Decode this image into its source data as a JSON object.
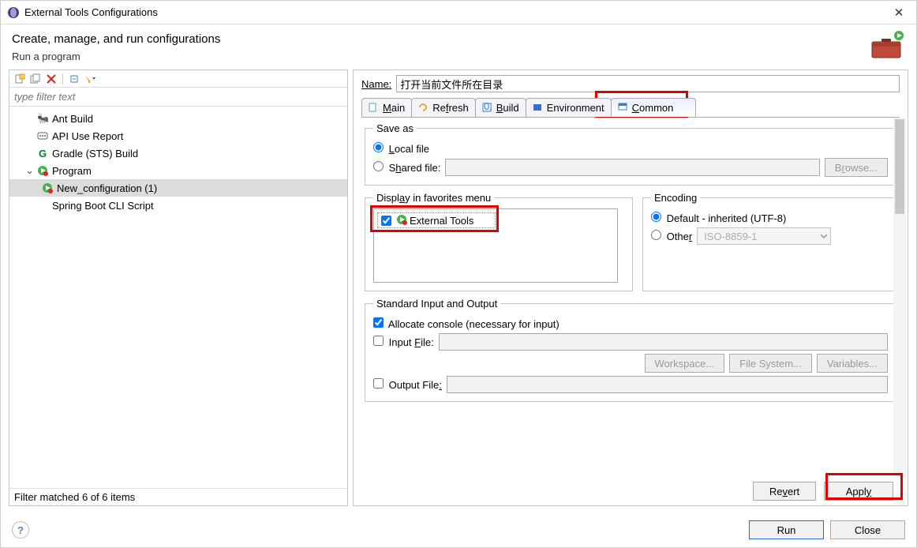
{
  "window": {
    "title": "External Tools Configurations",
    "close_glyph": "✕"
  },
  "header": {
    "title": "Create, manage, and run configurations",
    "subtitle": "Run a program"
  },
  "toolbar": {
    "new_icon": "new",
    "copy_icon": "copy",
    "delete_icon": "delete",
    "expand_icon": "expand",
    "collapse_icon": "collapse"
  },
  "filter": {
    "placeholder": "type filter text"
  },
  "tree": [
    {
      "label": "Ant Build",
      "icon": "ant"
    },
    {
      "label": "API Use Report",
      "icon": "api"
    },
    {
      "label": "Gradle (STS) Build",
      "icon": "gradle"
    },
    {
      "label": "Program",
      "icon": "program",
      "expanded": true,
      "children": [
        {
          "label": "New_configuration (1)",
          "icon": "program",
          "selected": true
        }
      ]
    },
    {
      "label": "Spring Boot CLI Script",
      "icon": "blank"
    }
  ],
  "status_line": "Filter matched 6 of 6 items",
  "name": {
    "label": "Name:",
    "value": "打开当前文件所在目录"
  },
  "tabs": [
    {
      "id": "main",
      "label": "Main",
      "underline": "M"
    },
    {
      "id": "refresh",
      "label": "Refresh",
      "underline": "f"
    },
    {
      "id": "build",
      "label": "Build",
      "underline": "B"
    },
    {
      "id": "environment",
      "label": "Environment"
    },
    {
      "id": "common",
      "label": "Common",
      "underline": "C",
      "active": true
    }
  ],
  "saveas": {
    "legend": "Save as",
    "local": "Local file",
    "shared": "Shared file:",
    "browse": "Browse..."
  },
  "favorites": {
    "legend": "Display in favorites menu",
    "item": "External Tools"
  },
  "encoding": {
    "legend": "Encoding",
    "default": "Default - inherited (UTF-8)",
    "other": "Other",
    "other_value": "ISO-8859-1"
  },
  "stdio": {
    "legend": "Standard Input and Output",
    "allocate": "Allocate console (necessary for input)",
    "input_file": "Input File:",
    "output_file": "Output File:",
    "workspace": "Workspace...",
    "filesystem": "File System...",
    "variables": "Variables..."
  },
  "buttons": {
    "revert": "Revert",
    "apply": "Apply",
    "run": "Run",
    "close": "Close"
  }
}
